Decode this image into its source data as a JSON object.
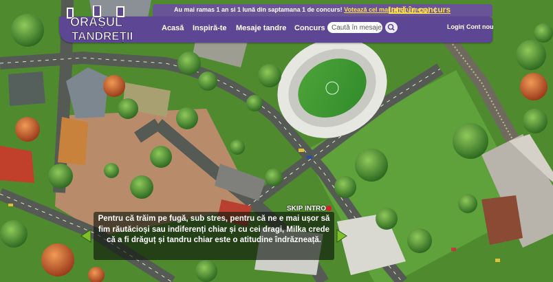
{
  "header": {
    "logo_text": [
      "ORAȘUL",
      "TANDREȚII"
    ],
    "countdown": "Au mai ramas 1 an si 1 lună din saptamana 1 de concurs!",
    "vote_link": "Votează cel mai tandru mesaj",
    "separator": "|",
    "enter_contest": "Intră în concurs"
  },
  "nav": {
    "items": [
      "Acasă",
      "Inspiră-te",
      "Mesaje tandre",
      "Concurs"
    ],
    "search_placeholder": "Caută în mesaje",
    "login": "Login",
    "auth_separator": "|",
    "signup": "Cont nou"
  },
  "intro": {
    "skip": "SKIP INTRO",
    "text": "Pentru că trăim pe fugă, sub stres, pentru că ne e mai ușor să fim răutăcioși sau indiferenți chiar și cu cei dragi, Milka crede că a fi drăguț și tandru chiar este o atitudine îndrăzneață."
  },
  "colors": {
    "brand_purple": "#5d4794",
    "accent_yellow": "#ffe14a",
    "grass": "#4f8a2f",
    "road": "#555a55",
    "plaza": "#b88c6a",
    "arrow_green": "#7fbf2a"
  }
}
